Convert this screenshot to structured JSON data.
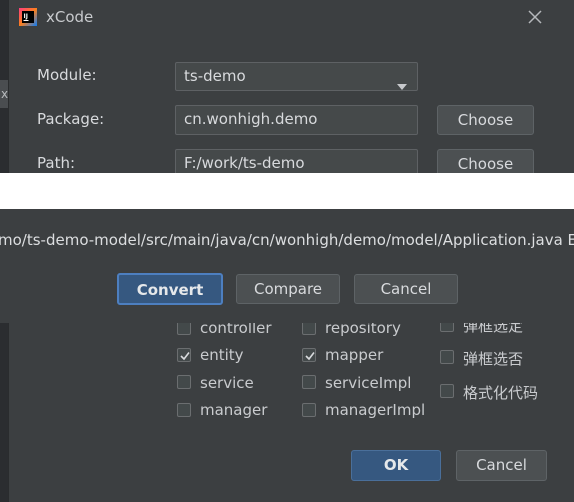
{
  "window": {
    "title": "xCode",
    "logo_text": "IJ"
  },
  "left_tab": {
    "glyph": "x"
  },
  "form": {
    "module_label": "Module:",
    "module_value": "ts-demo",
    "package_label": "Package:",
    "package_value": "cn.wonhigh.demo",
    "path_label": "Path:",
    "path_value": "F:/work/ts-demo",
    "choose_label": "Choose"
  },
  "popup": {
    "message": "mo/ts-demo-model/src/main/java/cn/wonhigh/demo/model/Application.java Ex",
    "convert_label": "Convert",
    "compare_label": "Compare",
    "cancel_label": "Cancel"
  },
  "options": {
    "col1": [
      {
        "label": "controller",
        "checked": false
      },
      {
        "label": "entity",
        "checked": true
      },
      {
        "label": "service",
        "checked": false
      },
      {
        "label": "manager",
        "checked": false
      }
    ],
    "col2": [
      {
        "label": "repository",
        "checked": false
      },
      {
        "label": "mapper",
        "checked": true
      },
      {
        "label": "serviceImpl",
        "checked": false
      },
      {
        "label": "managerImpl",
        "checked": false
      }
    ],
    "col3": [
      {
        "label": "弹框选定",
        "checked": false
      },
      {
        "label": "弹框选否",
        "checked": false
      },
      {
        "label": "格式化代码",
        "checked": false
      }
    ]
  },
  "footer": {
    "ok_label": "OK",
    "cancel_label": "Cancel"
  },
  "colors": {
    "primary": "#365880",
    "background": "#3c3f41",
    "field": "#45494a"
  }
}
